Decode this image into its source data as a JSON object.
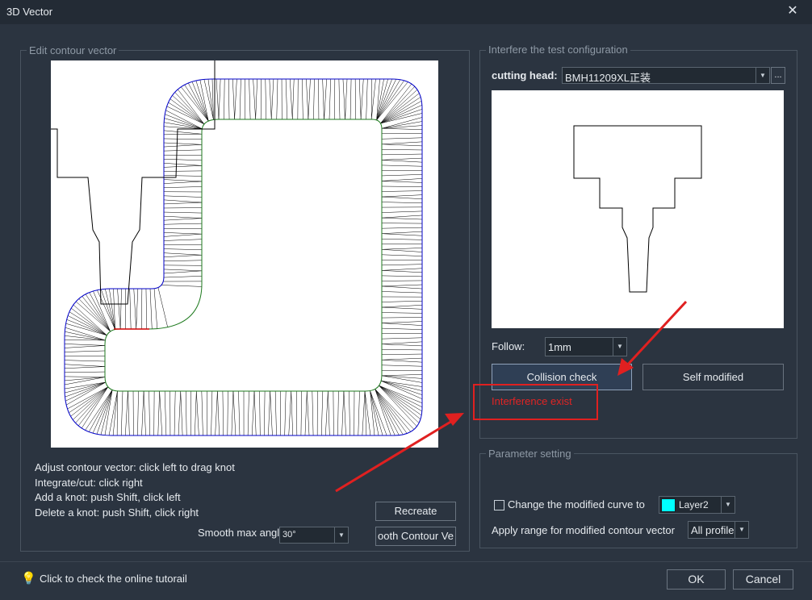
{
  "window": {
    "title": "3D Vector",
    "close_label": "✕"
  },
  "edit_group": {
    "legend": "Edit contour vector",
    "hints": [
      "Adjust contour vector: click left to drag knot",
      "Integrate/cut: click right",
      "Add a knot: push Shift, click left",
      "Delete a knot: push Shift, click right"
    ],
    "recreate_label": "Recreate",
    "smooth_label": "Smooth max angl",
    "smooth_value": "30°",
    "smooth_contour_label": "ooth Contour Ve"
  },
  "interfere_group": {
    "legend": "Interfere the test configuration",
    "cutting_head_label": "cutting head:",
    "cutting_head_value": "BMH11209XL正装",
    "browse_label": "...",
    "follow_label": "Follow:",
    "follow_value": "1mm",
    "collision_label": "Collision check",
    "self_modified_label": "Self modified",
    "status": "Interference exist"
  },
  "param_group": {
    "legend": "Parameter setting",
    "change_curve_label": "Change the modified curve to",
    "layer_value": "Layer2",
    "layer_color": "#00ffff",
    "apply_range_label": "Apply range for modified contour vector",
    "apply_range_value": "All profile"
  },
  "footer": {
    "tutorial_label": "Click to check the online tutorail",
    "ok_label": "OK",
    "cancel_label": "Cancel"
  },
  "colors": {
    "contour_outer": "#0000c8",
    "contour_inner": "#008000",
    "interference": "#d00000",
    "annotation_arrow": "#e02020"
  }
}
